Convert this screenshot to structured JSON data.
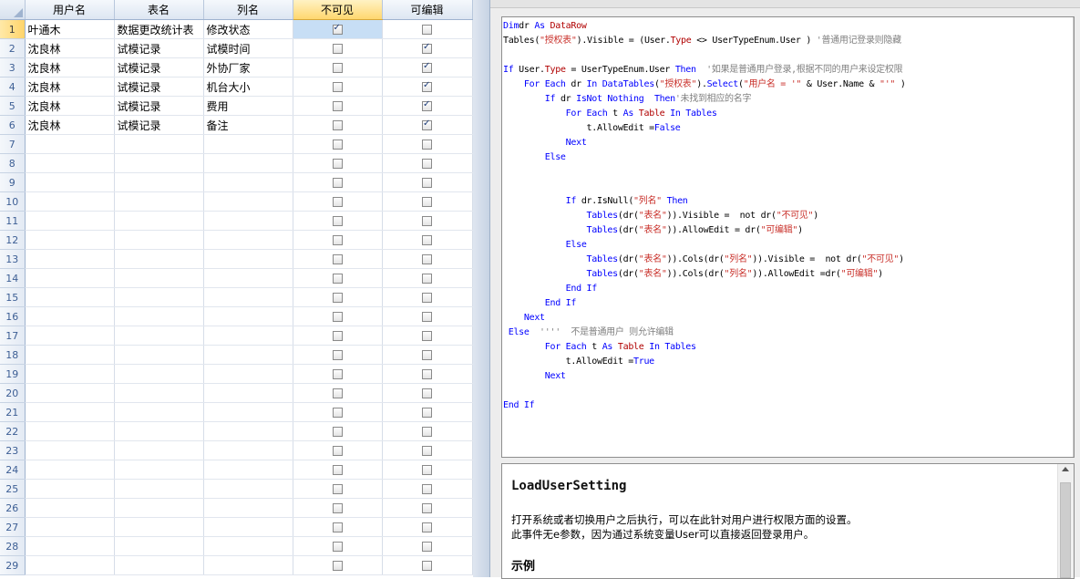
{
  "grid": {
    "columns": [
      "用户名",
      "表名",
      "列名",
      "不可见",
      "可编辑"
    ],
    "rows": [
      {
        "n": "1",
        "user": "叶通木",
        "table": "数据更改统计表",
        "col": "修改状态",
        "hidden": true,
        "edit": false
      },
      {
        "n": "2",
        "user": "沈良林",
        "table": "试模记录",
        "col": "试模时间",
        "hidden": false,
        "edit": true
      },
      {
        "n": "3",
        "user": "沈良林",
        "table": "试模记录",
        "col": "外协厂家",
        "hidden": false,
        "edit": true
      },
      {
        "n": "4",
        "user": "沈良林",
        "table": "试模记录",
        "col": "机台大小",
        "hidden": false,
        "edit": true
      },
      {
        "n": "5",
        "user": "沈良林",
        "table": "试模记录",
        "col": "费用",
        "hidden": false,
        "edit": true
      },
      {
        "n": "6",
        "user": "沈良林",
        "table": "试模记录",
        "col": "备注",
        "hidden": false,
        "edit": true
      },
      {
        "n": "7",
        "user": "",
        "table": "",
        "col": "",
        "hidden": false,
        "edit": false
      },
      {
        "n": "8",
        "user": "",
        "table": "",
        "col": "",
        "hidden": false,
        "edit": false
      },
      {
        "n": "9",
        "user": "",
        "table": "",
        "col": "",
        "hidden": false,
        "edit": false
      },
      {
        "n": "10",
        "user": "",
        "table": "",
        "col": "",
        "hidden": false,
        "edit": false
      },
      {
        "n": "11",
        "user": "",
        "table": "",
        "col": "",
        "hidden": false,
        "edit": false
      },
      {
        "n": "12",
        "user": "",
        "table": "",
        "col": "",
        "hidden": false,
        "edit": false
      },
      {
        "n": "13",
        "user": "",
        "table": "",
        "col": "",
        "hidden": false,
        "edit": false
      },
      {
        "n": "14",
        "user": "",
        "table": "",
        "col": "",
        "hidden": false,
        "edit": false
      },
      {
        "n": "15",
        "user": "",
        "table": "",
        "col": "",
        "hidden": false,
        "edit": false
      },
      {
        "n": "16",
        "user": "",
        "table": "",
        "col": "",
        "hidden": false,
        "edit": false
      },
      {
        "n": "17",
        "user": "",
        "table": "",
        "col": "",
        "hidden": false,
        "edit": false
      },
      {
        "n": "18",
        "user": "",
        "table": "",
        "col": "",
        "hidden": false,
        "edit": false
      },
      {
        "n": "19",
        "user": "",
        "table": "",
        "col": "",
        "hidden": false,
        "edit": false
      },
      {
        "n": "20",
        "user": "",
        "table": "",
        "col": "",
        "hidden": false,
        "edit": false
      },
      {
        "n": "21",
        "user": "",
        "table": "",
        "col": "",
        "hidden": false,
        "edit": false
      },
      {
        "n": "22",
        "user": "",
        "table": "",
        "col": "",
        "hidden": false,
        "edit": false
      },
      {
        "n": "23",
        "user": "",
        "table": "",
        "col": "",
        "hidden": false,
        "edit": false
      },
      {
        "n": "24",
        "user": "",
        "table": "",
        "col": "",
        "hidden": false,
        "edit": false
      },
      {
        "n": "25",
        "user": "",
        "table": "",
        "col": "",
        "hidden": false,
        "edit": false
      },
      {
        "n": "26",
        "user": "",
        "table": "",
        "col": "",
        "hidden": false,
        "edit": false
      },
      {
        "n": "27",
        "user": "",
        "table": "",
        "col": "",
        "hidden": false,
        "edit": false
      },
      {
        "n": "28",
        "user": "",
        "table": "",
        "col": "",
        "hidden": false,
        "edit": false
      },
      {
        "n": "29",
        "user": "",
        "table": "",
        "col": "",
        "hidden": false,
        "edit": false
      }
    ]
  },
  "code": {
    "lines": [
      [
        [
          "kw",
          "Dim"
        ],
        [
          "",
          "dr"
        ],
        [
          "kw",
          " As "
        ],
        [
          "ty",
          "DataRow"
        ]
      ],
      [
        [
          "",
          "Tables("
        ],
        [
          "st",
          "\"授权表\""
        ],
        [
          "",
          ").Visible = (User."
        ],
        [
          "ty",
          "Type"
        ],
        [
          "",
          " <> UserTypeEnum.User ) "
        ],
        [
          "cm",
          "'普通用记登录则隐藏"
        ]
      ],
      [],
      [
        [
          "kw",
          "If"
        ],
        [
          "",
          " User."
        ],
        [
          "ty",
          "Type"
        ],
        [
          "",
          " = UserTypeEnum.User "
        ],
        [
          "kw",
          "Then"
        ],
        [
          "cm",
          "  '如果是普通用户登录,根据不同的用户来设定权限"
        ]
      ],
      [
        [
          "",
          "    "
        ],
        [
          "kw",
          "For Each"
        ],
        [
          "",
          " dr "
        ],
        [
          "kw",
          "In"
        ],
        [
          "kw",
          " DataTables"
        ],
        [
          "",
          "("
        ],
        [
          "st",
          "\"授权表\""
        ],
        [
          "",
          ")."
        ],
        [
          "kw",
          "Select"
        ],
        [
          "",
          "("
        ],
        [
          "st",
          "\"用户名 = '\""
        ],
        [
          "",
          " & User.Name & "
        ],
        [
          "st",
          "\"'\""
        ],
        [
          "",
          " )"
        ]
      ],
      [
        [
          "",
          "        "
        ],
        [
          "kw",
          "If"
        ],
        [
          "",
          " dr "
        ],
        [
          "kw",
          "IsNot Nothing"
        ],
        [
          "",
          "  "
        ],
        [
          "kw",
          "Then"
        ],
        [
          "cm",
          "'未找到相应的名字"
        ]
      ],
      [
        [
          "",
          "            "
        ],
        [
          "kw",
          "For Each"
        ],
        [
          "",
          " t "
        ],
        [
          "kw",
          "As"
        ],
        [
          "",
          " "
        ],
        [
          "ty",
          "Table"
        ],
        [
          "kw",
          " In Tables"
        ]
      ],
      [
        [
          "",
          "                t.AllowEdit ="
        ],
        [
          "kw",
          "False"
        ]
      ],
      [
        [
          "",
          "            "
        ],
        [
          "kw",
          "Next"
        ]
      ],
      [
        [
          "",
          "        "
        ],
        [
          "kw",
          "Else"
        ]
      ],
      [],
      [],
      [
        [
          "",
          "            "
        ],
        [
          "kw",
          "If"
        ],
        [
          "",
          " dr.IsNull("
        ],
        [
          "st",
          "\"列名\""
        ],
        [
          ")",
          " "
        ],
        [
          "kw",
          "Then"
        ]
      ],
      [
        [
          "",
          "                "
        ],
        [
          "kw",
          "Tables"
        ],
        [
          "",
          "(dr("
        ],
        [
          "st",
          "\"表名\""
        ],
        [
          "",
          ")).Visible =  not dr("
        ],
        [
          "st",
          "\"不可见\""
        ],
        [
          "",
          ")"
        ]
      ],
      [
        [
          "",
          "                "
        ],
        [
          "kw",
          "Tables"
        ],
        [
          "",
          "(dr("
        ],
        [
          "st",
          "\"表名\""
        ],
        [
          "",
          ")).AllowEdit = dr("
        ],
        [
          "st",
          "\"可编辑\""
        ],
        [
          "",
          ")"
        ]
      ],
      [
        [
          "",
          "            "
        ],
        [
          "kw",
          "Else"
        ]
      ],
      [
        [
          "",
          "                "
        ],
        [
          "kw",
          "Tables"
        ],
        [
          "",
          "(dr("
        ],
        [
          "st",
          "\"表名\""
        ],
        [
          "",
          ")).Cols(dr("
        ],
        [
          "st",
          "\"列名\""
        ],
        [
          "",
          ")).Visible =  not dr("
        ],
        [
          "st",
          "\"不可见\""
        ],
        [
          "",
          ")"
        ]
      ],
      [
        [
          "",
          "                "
        ],
        [
          "kw",
          "Tables"
        ],
        [
          "",
          "(dr("
        ],
        [
          "st",
          "\"表名\""
        ],
        [
          "",
          ")).Cols(dr("
        ],
        [
          "st",
          "\"列名\""
        ],
        [
          "",
          ")).AllowEdit =dr("
        ],
        [
          "st",
          "\"可编辑\""
        ],
        [
          "",
          ")"
        ]
      ],
      [
        [
          "",
          "            "
        ],
        [
          "kw",
          "End If"
        ]
      ],
      [
        [
          "",
          "        "
        ],
        [
          "kw",
          "End If"
        ]
      ],
      [
        [
          "",
          "    "
        ],
        [
          "kw",
          "Next"
        ]
      ],
      [
        [
          "kw",
          " Else"
        ],
        [
          "cm",
          "  ''''  不是普通用户 则允许编辑"
        ]
      ],
      [
        [
          "",
          "        "
        ],
        [
          "kw",
          "For Each"
        ],
        [
          "",
          " t "
        ],
        [
          "kw",
          "As"
        ],
        [
          "",
          " "
        ],
        [
          "ty",
          "Table"
        ],
        [
          "kw",
          " In Tables"
        ]
      ],
      [
        [
          "",
          "            t.AllowEdit ="
        ],
        [
          "kw",
          "True"
        ]
      ],
      [
        [
          "",
          "        "
        ],
        [
          "kw",
          "Next"
        ]
      ],
      [],
      [
        [
          "kw",
          "End If"
        ]
      ]
    ]
  },
  "help": {
    "title": "LoadUserSetting",
    "line1": "打开系统或者切换用户之后执行，可以在此针对用户进行权限方面的设置。",
    "line2": "此事件无e参数，因为通过系统变量User可以直接返回登录用户。",
    "example": "示例"
  }
}
